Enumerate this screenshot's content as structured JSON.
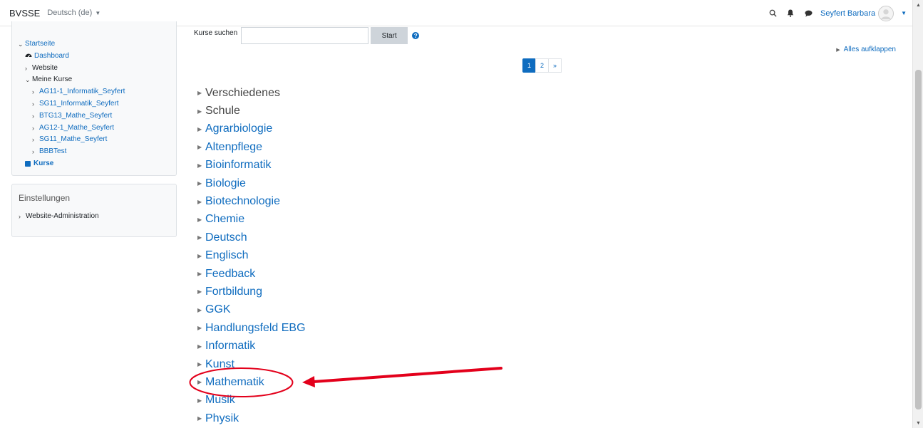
{
  "navbar": {
    "brand": "BVSSE",
    "language": "Deutsch (de)",
    "user_name": "Seyfert Barbara"
  },
  "sidebar": {
    "navigation": {
      "items": [
        {
          "label": "Startseite",
          "level": 1,
          "expander": "open"
        },
        {
          "label": "Dashboard",
          "level": 2,
          "icon": "dashboard-icon"
        },
        {
          "label": "Website",
          "level": 2,
          "expander": "closed"
        },
        {
          "label": "Meine Kurse",
          "level": 2,
          "expander": "open"
        },
        {
          "label": "AG11-1_Informatik_Seyfert",
          "level": 3,
          "expander": "closed"
        },
        {
          "label": "SG11_Informatik_Seyfert",
          "level": 3,
          "expander": "closed"
        },
        {
          "label": "BTG13_Mathe_Seyfert",
          "level": 3,
          "expander": "closed"
        },
        {
          "label": "AG12-1_Mathe_Seyfert",
          "level": 3,
          "expander": "closed"
        },
        {
          "label": "SG11_Mathe_Seyfert",
          "level": 3,
          "expander": "closed"
        },
        {
          "label": "BBBTest",
          "level": 3,
          "expander": "closed"
        },
        {
          "label": "Kurse",
          "level": 2,
          "icon": "courses-icon"
        }
      ]
    },
    "settings": {
      "title": "Einstellungen",
      "items": [
        "Website-Administration"
      ]
    }
  },
  "search": {
    "label": "Kurse suchen",
    "value": "",
    "button": "Start"
  },
  "expand_all": "Alles aufklappen",
  "pagination": [
    "1",
    "2",
    "»"
  ],
  "categories": [
    "Verschiedenes",
    "Schule",
    "Agrarbiologie",
    "Altenpflege",
    "Bioinformatik",
    "Biologie",
    "Biotechnologie",
    "Chemie",
    "Deutsch",
    "Englisch",
    "Feedback",
    "Fortbildung",
    "GGK",
    "Handlungsfeld EBG",
    "Informatik",
    "Kunst",
    "Mathematik",
    "Musik",
    "Physik"
  ],
  "highlight": {
    "target": "Mathematik",
    "color": "#e3001b"
  },
  "colors": {
    "link": "#0f6cbf",
    "annotation": "#e3001b"
  }
}
